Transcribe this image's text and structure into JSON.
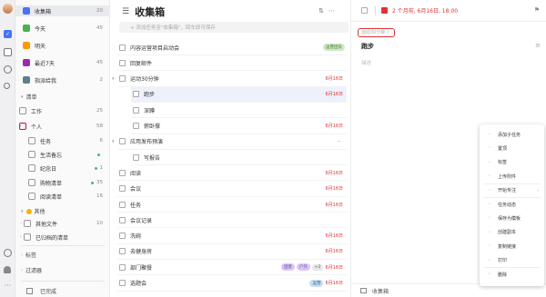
{
  "colors": {
    "accent": "#4772fa",
    "date_red": "#d33",
    "tag_green": "#cfe9c6",
    "tag_purple": "#d8c9f2",
    "tag_blue": "#c9ddf2"
  },
  "rail_icons": [
    "avatar",
    "checkbox-icon",
    "calendar-icon",
    "compass-icon",
    "search-icon",
    "sync-icon",
    "bell-icon",
    "more-icon"
  ],
  "sidebar": {
    "smart": [
      {
        "label": "收集箱",
        "count": "20",
        "icon": "inbox-icon",
        "color": "#4772fa"
      },
      {
        "label": "今天",
        "count": "45",
        "icon": "today-icon",
        "color": "#4caf50"
      },
      {
        "label": "明天",
        "count": "",
        "icon": "tomorrow-icon",
        "color": "#ff9800"
      },
      {
        "label": "最近7天",
        "count": "45",
        "icon": "week-icon",
        "color": "#9c27b0"
      },
      {
        "label": "指派给我",
        "count": "2",
        "icon": "assigned-icon",
        "color": "#607d8b"
      }
    ],
    "lists_header": "清单",
    "lists": [
      {
        "label": "工作",
        "count": "25",
        "type": "folder"
      },
      {
        "label": "个人",
        "count": "58",
        "type": "folder-open"
      },
      {
        "label": "任务",
        "count": "6",
        "type": "list"
      },
      {
        "label": "生活备忘",
        "count": "",
        "type": "list",
        "dot": "#3ab7a6"
      },
      {
        "label": "纪念日",
        "count": "1",
        "type": "list",
        "dot": "#3ab7a6"
      },
      {
        "label": "购物清单",
        "count": "35",
        "type": "list",
        "dot": "#3ab7a6"
      },
      {
        "label": "阅读清单",
        "count": "16",
        "type": "list"
      }
    ],
    "others_header": "其他",
    "others": [
      {
        "label": "其他文件",
        "count": "10"
      },
      {
        "label": "已归档的清单",
        "count": ""
      }
    ],
    "tags_header": "标签",
    "filters_header": "过滤器",
    "done_label": "已完成"
  },
  "list": {
    "title": "收集箱",
    "add_placeholder": "+ 添加任务至\"收集箱\"，回车即可保存",
    "tasks": [
      {
        "title": "内容运营项目启动会",
        "date": "",
        "tags": [
          {
            "t": "运营团队",
            "c": "#cfe9c6",
            "fc": "#3e7a2f"
          }
        ],
        "indent": 0
      },
      {
        "title": "回复邮件",
        "date": "",
        "tags": [],
        "indent": 0
      },
      {
        "title": "运动30分钟",
        "date": "6月16日",
        "tags": [],
        "indent": 0,
        "collapse": true
      },
      {
        "title": "跑步",
        "date": "6月16日",
        "tags": [],
        "indent": 1,
        "selected": true
      },
      {
        "title": "深蹲",
        "date": "",
        "tags": [],
        "indent": 1
      },
      {
        "title": "俯卧撑",
        "date": "6月16日",
        "tags": [],
        "indent": 1
      },
      {
        "title": "应用发布预演",
        "date": "",
        "tags": [],
        "indent": 0,
        "collapse": true
      },
      {
        "title": "写报告",
        "date": "",
        "tags": [],
        "indent": 1
      },
      {
        "title": "阅读",
        "date": "6月16日",
        "tags": [],
        "indent": 0
      },
      {
        "title": "会议",
        "date": "6月16日",
        "tags": [],
        "indent": 0
      },
      {
        "title": "任务",
        "date": "6月16日",
        "tags": [],
        "indent": 0
      },
      {
        "title": "会议记录",
        "date": "",
        "tags": [],
        "indent": 0
      },
      {
        "title": "洗碗",
        "date": "6月16日",
        "tags": [],
        "indent": 0
      },
      {
        "title": "去健身房",
        "date": "6月16日",
        "tags": [],
        "indent": 0
      },
      {
        "title": "部门聚餐",
        "date": "6月16日",
        "tags": [
          {
            "t": "团建",
            "c": "#d8c9f2",
            "fc": "#6a4aa8"
          },
          {
            "t": "户外",
            "c": "#d8c9f2",
            "fc": "#6a4aa8"
          },
          {
            "t": "+2",
            "c": "#e6e6e6",
            "fc": "#666"
          }
        ],
        "indent": 0
      },
      {
        "title": "选题会",
        "date": "6月16日",
        "tags": [
          {
            "t": "运营",
            "c": "#c9ddf2",
            "fc": "#2f5f8c"
          }
        ],
        "indent": 0
      }
    ]
  },
  "detail": {
    "due": "2 个月前, 6月16日, 18:00",
    "parent": "运动30分钟 〉",
    "title": "跑步",
    "desc_placeholder": "描述",
    "footer_list": "收集箱"
  },
  "context_menu": [
    {
      "label": "添加子任务",
      "icon": "subtask-icon"
    },
    {
      "label": "置顶",
      "icon": "pin-icon"
    },
    {
      "label": "标签",
      "icon": "tag-icon"
    },
    {
      "label": "上传附件",
      "icon": "attach-icon"
    },
    {
      "label": "开始专注",
      "icon": "focus-icon",
      "arrow": "›"
    },
    {
      "label": "任务动态",
      "icon": "activity-icon"
    },
    {
      "label": "保存为模板",
      "icon": "template-icon"
    },
    {
      "label": "创建副本",
      "icon": "copy-icon"
    },
    {
      "label": "复制链接",
      "icon": "link-icon"
    },
    {
      "label": "打印",
      "icon": "print-icon"
    },
    {
      "label": "删除",
      "icon": "delete-icon"
    }
  ]
}
